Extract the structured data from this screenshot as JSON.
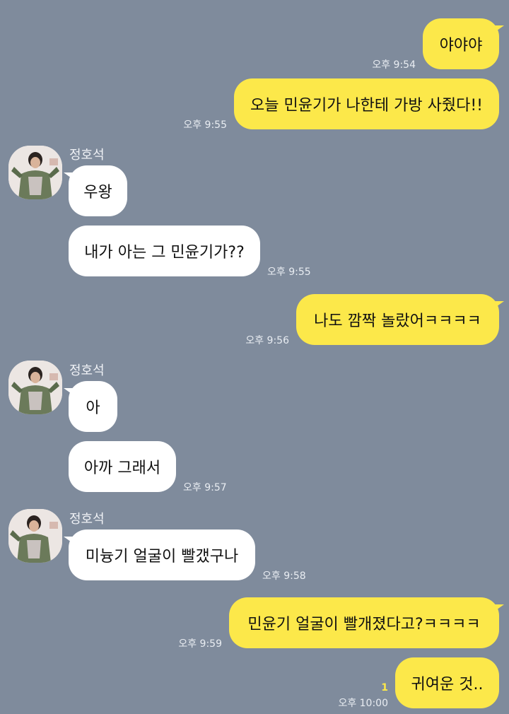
{
  "contact": {
    "name": "정호석"
  },
  "colors": {
    "background": "#7f8b9c",
    "my_bubble": "#fce84a",
    "their_bubble": "#ffffff"
  },
  "messages": [
    {
      "sender": "me",
      "text": "야야야",
      "time": "오후 9:54"
    },
    {
      "sender": "me",
      "text": "오늘 민윤기가 나한테 가방 사줬다!!",
      "time": "오후 9:55"
    },
    {
      "sender": "other",
      "text": "우왕",
      "time": ""
    },
    {
      "sender": "other",
      "text": "내가 아는 그 민윤기가??",
      "time": "오후 9:55"
    },
    {
      "sender": "me",
      "text": "나도 깜짝 놀랐어ㅋㅋㅋㅋ",
      "time": "오후 9:56"
    },
    {
      "sender": "other",
      "text": "아",
      "time": ""
    },
    {
      "sender": "other",
      "text": "아까 그래서",
      "time": "오후 9:57"
    },
    {
      "sender": "other",
      "text": "미늉기 얼굴이 빨갰구나",
      "time": "오후 9:58"
    },
    {
      "sender": "me",
      "text": "민윤기 얼굴이 빨개졌다고?ㅋㅋㅋㅋ",
      "time": "오후 9:59"
    },
    {
      "sender": "me",
      "text": "귀여운 것..",
      "time": "오후 10:00",
      "unread": "1"
    }
  ]
}
